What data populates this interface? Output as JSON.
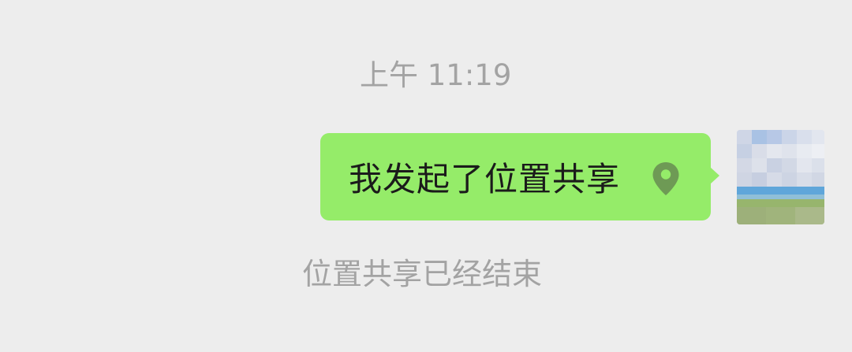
{
  "chat": {
    "timestamp": "上午 11:19",
    "messages": [
      {
        "sender": "self",
        "text": "我发起了位置共享",
        "icon": "location-pin-icon"
      }
    ],
    "system_notice": "位置共享已经结束"
  },
  "colors": {
    "background": "#ededed",
    "bubble": "#95ec69",
    "bubble_text": "#1b1b1b",
    "meta_text": "#a3a3a3",
    "pin": "#6e9a55"
  }
}
